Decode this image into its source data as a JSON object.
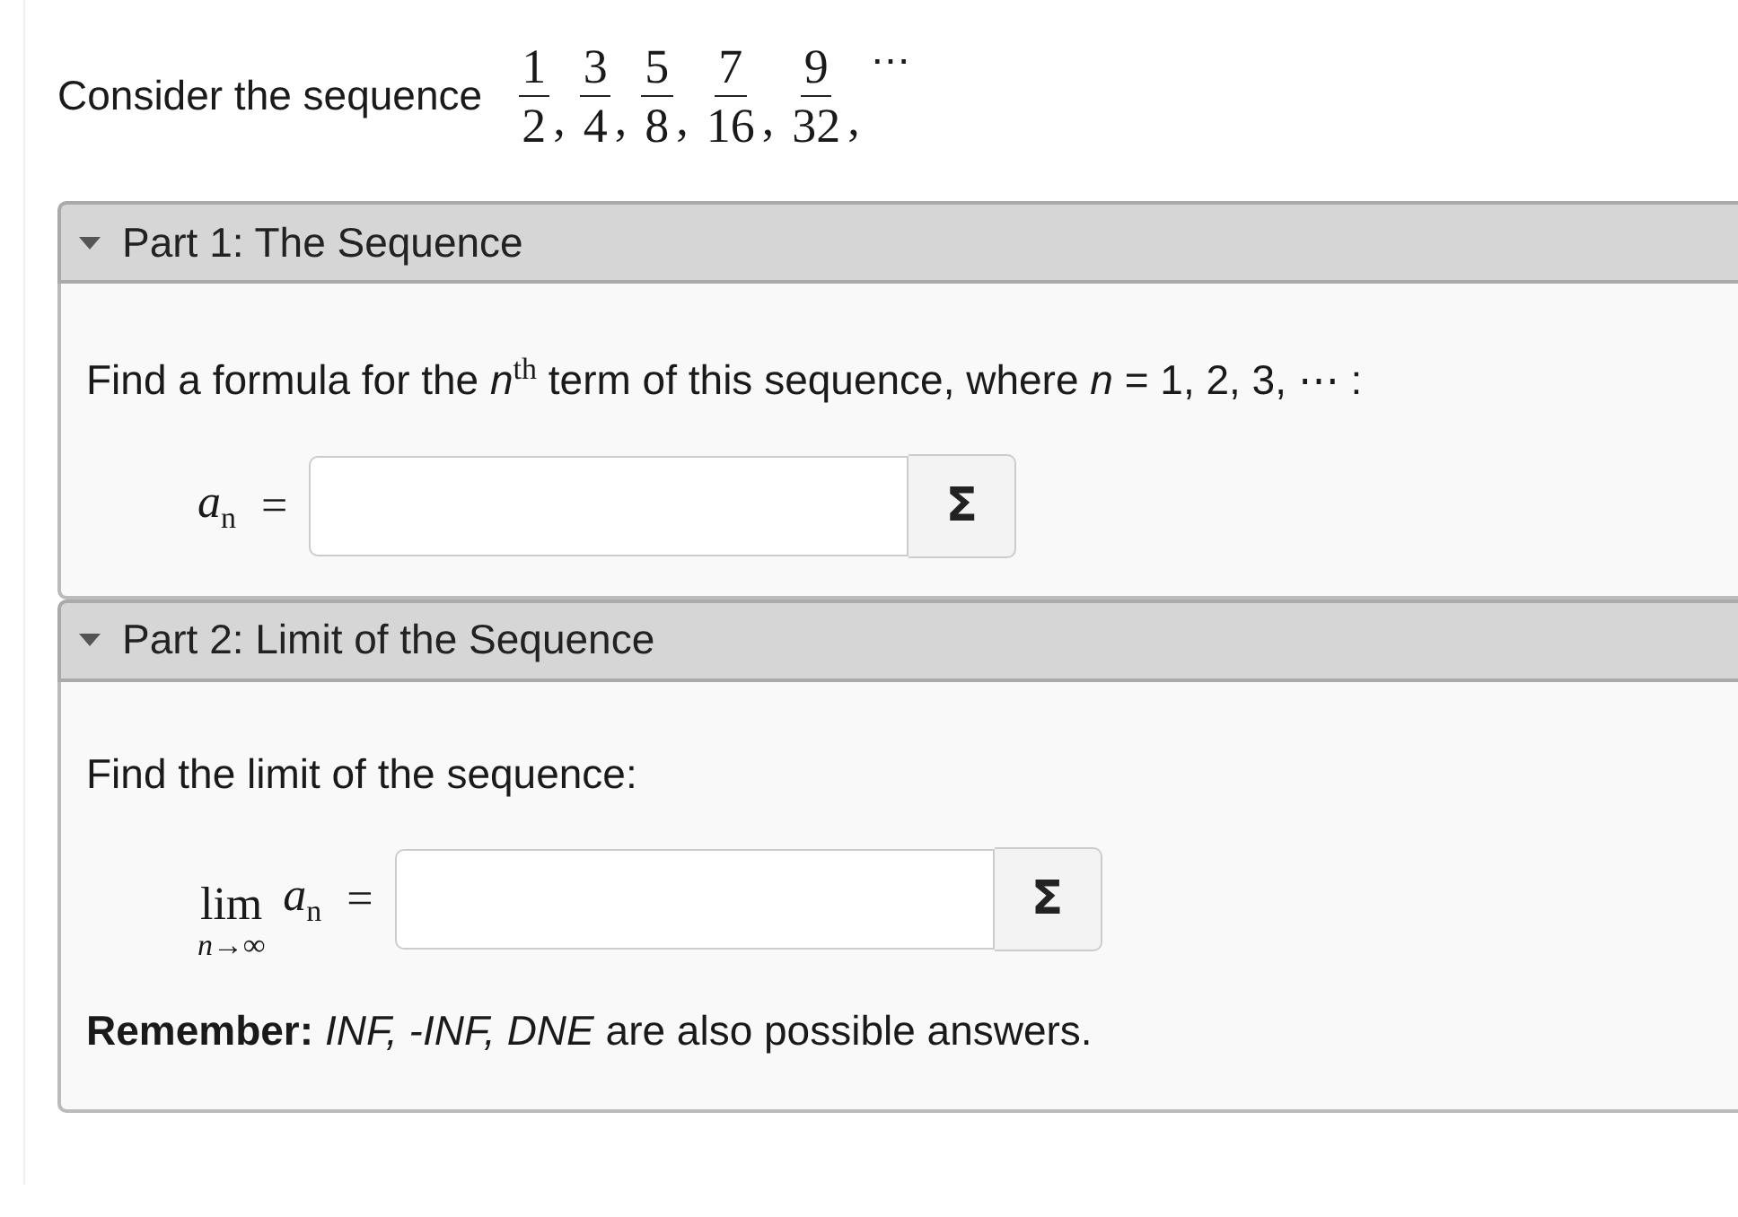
{
  "intro": {
    "text": "Consider the sequence",
    "terms": [
      {
        "num": "1",
        "den": "2"
      },
      {
        "num": "3",
        "den": "4"
      },
      {
        "num": "5",
        "den": "8"
      },
      {
        "num": "7",
        "den": "16"
      },
      {
        "num": "9",
        "den": "32"
      }
    ],
    "separator": ",",
    "ellipsis": "⋯"
  },
  "parts": [
    {
      "title": "Part 1: The Sequence",
      "expanded": true,
      "prompt": "Find a formula for the *n*$^{th}$ term of this sequence, where *n* = 1, 2, 3, ⋯ :",
      "answer": {
        "kind": "plain",
        "label": "*a*$_{n}$",
        "equals": "=",
        "button": "Σ"
      }
    },
    {
      "title": "Part 2: Limit of the Sequence",
      "expanded": true,
      "prompt": "Find the limit of the sequence:",
      "answer": {
        "kind": "limit",
        "lim": "lim",
        "under": "n→∞",
        "label": "*a*$_{n}$",
        "equals": "=",
        "button": "Σ"
      },
      "note": "**Remember:** *INF, -INF, DNE* are also possible answers."
    }
  ]
}
